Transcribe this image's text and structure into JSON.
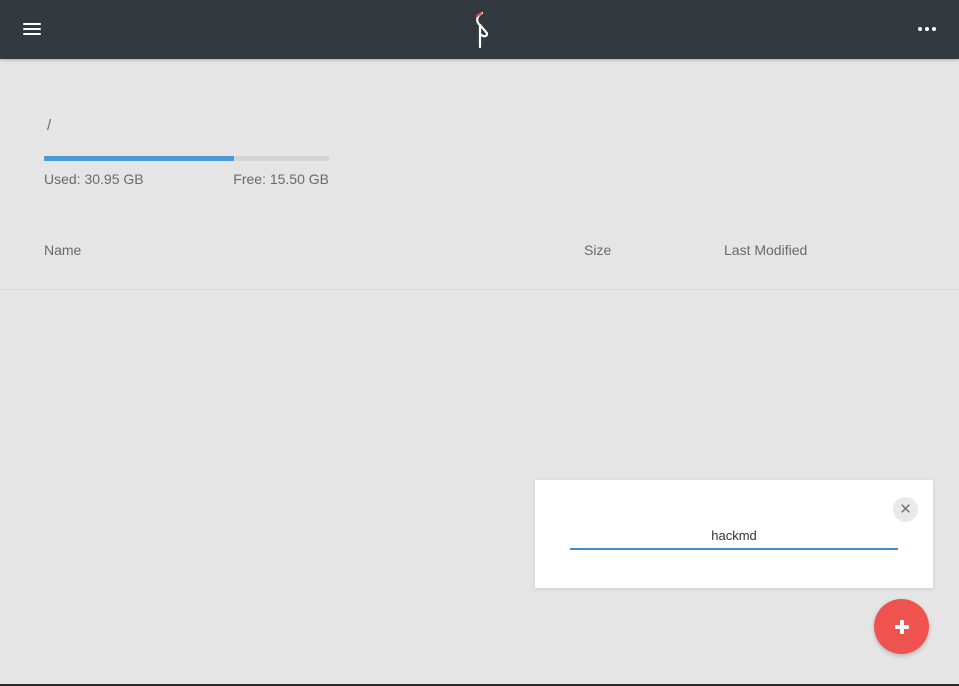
{
  "header": {
    "menu_icon": "hamburger-menu-icon",
    "logo_icon": "minio-flamingo-logo",
    "more_icon": "ellipsis-horizontal-icon",
    "bg_color": "#32393f"
  },
  "browser": {
    "path": "/",
    "storage": {
      "used_label": "Used: 30.95 GB",
      "free_label": "Free: 15.50 GB",
      "used_fraction": 0.666,
      "bar_color": "#4a9bd4"
    },
    "columns": {
      "name": "Name",
      "size": "Size",
      "last_modified": "Last Modified"
    }
  },
  "dialog": {
    "input_value": "hackmd",
    "close_icon": "close-icon",
    "accent_color": "#3a8fcc"
  },
  "fab": {
    "icon": "plus-icon",
    "color": "#ef5350"
  }
}
